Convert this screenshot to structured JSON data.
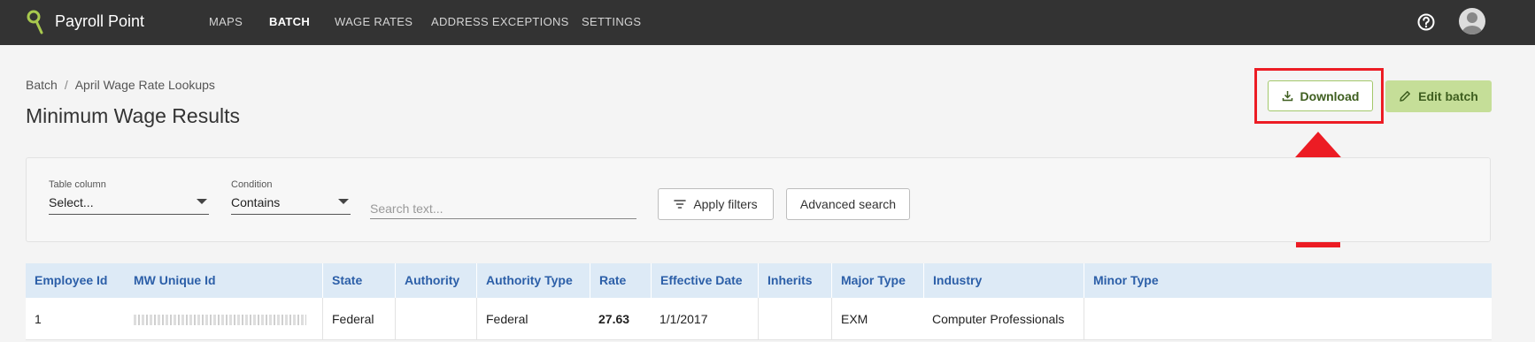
{
  "app": {
    "title": "Payroll Point"
  },
  "nav": [
    {
      "label": "MAPS"
    },
    {
      "label": "BATCH"
    },
    {
      "label": "WAGE RATES"
    },
    {
      "label": "ADDRESS EXCEPTIONS"
    },
    {
      "label": "SETTINGS"
    }
  ],
  "nav_active": "BATCH",
  "icons": {
    "logo": "location-pin-logo-icon",
    "help": "help-icon",
    "avatar": "user-avatar-icon",
    "download": "download-icon",
    "edit": "pencil-icon",
    "filter": "filter-icon"
  },
  "breadcrumb": {
    "root": "Batch",
    "current": "April Wage Rate Lookups"
  },
  "page_title": "Minimum Wage Results",
  "actions": {
    "download_label": "Download",
    "edit_label": "Edit batch"
  },
  "annotation": {
    "highlight_color": "#ec1c24"
  },
  "filters": {
    "table_column": {
      "label": "Table column",
      "value": "Select..."
    },
    "condition": {
      "label": "Condition",
      "value": "Contains"
    },
    "search": {
      "placeholder": "Search text...",
      "value": ""
    },
    "apply_label": "Apply filters",
    "advanced_label": "Advanced search"
  },
  "table": {
    "columns": [
      "Employee Id",
      "MW Unique Id",
      "State",
      "Authority",
      "Authority Type",
      "Rate",
      "Effective Date",
      "Inherits",
      "Major Type",
      "Industry",
      "Minor Type"
    ],
    "rows": [
      {
        "employee_id": "1",
        "mw_unique_id": "",
        "state": "Federal",
        "authority": "",
        "authority_type": "Federal",
        "rate": "27.63",
        "effective_date": "1/1/2017",
        "inherits": "",
        "major_type": "EXM",
        "industry": "Computer Professionals",
        "minor_type": ""
      }
    ]
  },
  "colors": {
    "topbar": "#333333",
    "accent_green": "#c5de98",
    "header_blue": "#2c5fa8",
    "table_header_bg": "#ddeaf6"
  }
}
